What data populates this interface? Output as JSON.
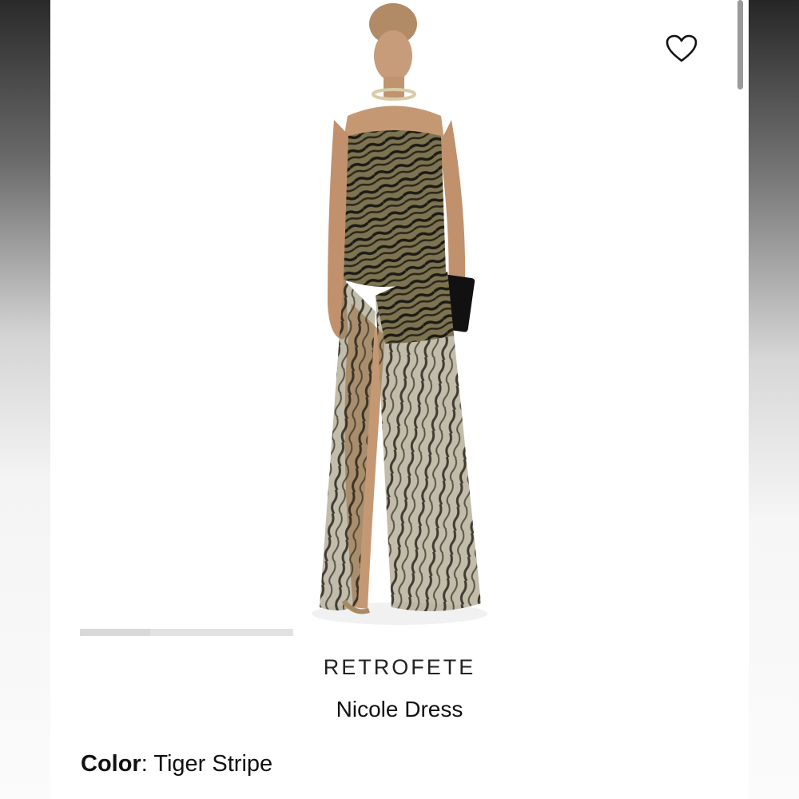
{
  "product": {
    "brand": "RETROFETE",
    "name": "Nicole Dress",
    "color_label": "Color",
    "color_separator": ":",
    "color_value": "Tiger Stripe"
  },
  "gallery": {
    "progress": 0.33
  },
  "icons": {
    "favorite": "heart-outline-icon"
  },
  "colors": {
    "page_background": "#ffffff",
    "text": "#111111",
    "progress_track": "#e2e2e2"
  }
}
